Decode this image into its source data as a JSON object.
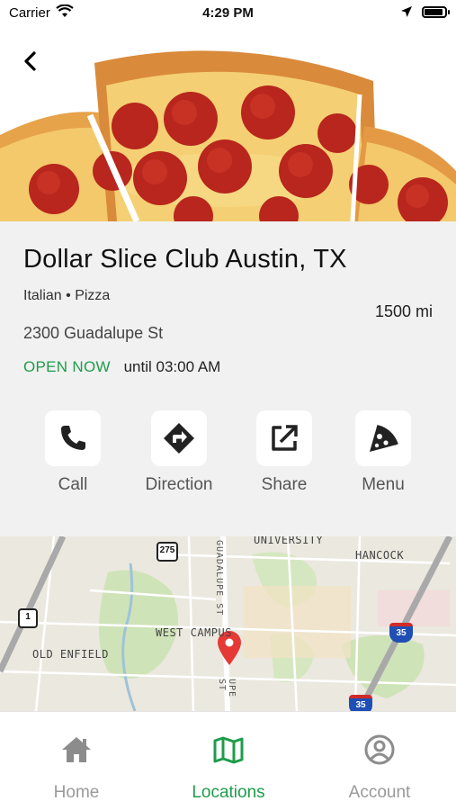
{
  "status_bar": {
    "carrier": "Carrier",
    "time": "4:29 PM",
    "battery_level": 0.9
  },
  "header": {
    "back_icon": "chevron-left-icon",
    "hero_image": "pepperoni-pizza"
  },
  "restaurant": {
    "name": "Dollar Slice Club Austin, TX",
    "tags": "Italian • Pizza",
    "distance": "1500 mi",
    "address": "2300 Guadalupe St",
    "open_status": "OPEN NOW",
    "hours_text": "until 03:00 AM",
    "accent_color": "#1e9c4b"
  },
  "actions": [
    {
      "label": "Call",
      "icon": "phone-icon"
    },
    {
      "label": "Direction",
      "icon": "direction-icon"
    },
    {
      "label": "Share",
      "icon": "share-icon"
    },
    {
      "label": "Menu",
      "icon": "pizza-slice-icon"
    }
  ],
  "map": {
    "labels": {
      "university": "UNIVERSITY",
      "hancock": "HANCOCK",
      "west_campus": "WEST CAMPUS",
      "old_enfield": "OLD ENFIELD",
      "guadalupe_top": "GUADALUPE ST",
      "guadalupe_bottom": "UPE ST"
    },
    "shields": {
      "route_275": "275",
      "route_1": "1",
      "interstate_35_a": "35",
      "interstate_35_b": "35"
    },
    "pin_color": "#e53935"
  },
  "tabbar": {
    "tabs": [
      {
        "label": "Home",
        "icon": "home-icon",
        "active": false
      },
      {
        "label": "Locations",
        "icon": "map-icon",
        "active": true
      },
      {
        "label": "Account",
        "icon": "account-icon",
        "active": false
      }
    ]
  }
}
